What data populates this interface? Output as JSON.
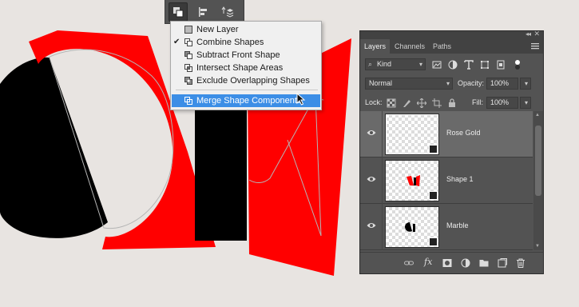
{
  "menu": {
    "items": [
      {
        "label": "New Layer",
        "checked": false,
        "highlighted": false
      },
      {
        "label": "Combine Shapes",
        "checked": true,
        "highlighted": false
      },
      {
        "label": "Subtract Front Shape",
        "checked": false,
        "highlighted": false
      },
      {
        "label": "Intersect Shape Areas",
        "checked": false,
        "highlighted": false
      },
      {
        "label": "Exclude Overlapping Shapes",
        "checked": false,
        "highlighted": false
      },
      {
        "label": "Merge Shape Components",
        "checked": false,
        "highlighted": true
      }
    ],
    "check_mark": "✔",
    "highlight_color": "#3c8ee6"
  },
  "panel": {
    "tabs": [
      "Layers",
      "Channels",
      "Paths"
    ],
    "active_tab": "Layers",
    "filter": {
      "value": "Kind",
      "search_glyph": "⌕"
    },
    "blend_mode": "Normal",
    "opacity": {
      "label": "Opacity:",
      "value": "100%"
    },
    "lock_label": "Lock:",
    "fill": {
      "label": "Fill:",
      "value": "100%"
    },
    "layers": [
      {
        "name": "Rose Gold",
        "selected": true,
        "visible": true
      },
      {
        "name": "Shape 1",
        "selected": false,
        "visible": true
      },
      {
        "name": "Marble",
        "selected": false,
        "visible": true
      }
    ],
    "footer_icons": [
      "link-icon",
      "fx-icon",
      "mask-icon",
      "adjustment-icon",
      "group-icon",
      "new-layer-icon",
      "trash-icon"
    ],
    "fx_label": "fx",
    "collapse_glyph": "◂◂",
    "close_glyph": "✕"
  },
  "colors": {
    "canvas_bg": "#e8e4e1",
    "shape_red": "#ff0000",
    "shape_black": "#000000",
    "panel_bg": "#535353",
    "accent": "#3c8ee6"
  }
}
